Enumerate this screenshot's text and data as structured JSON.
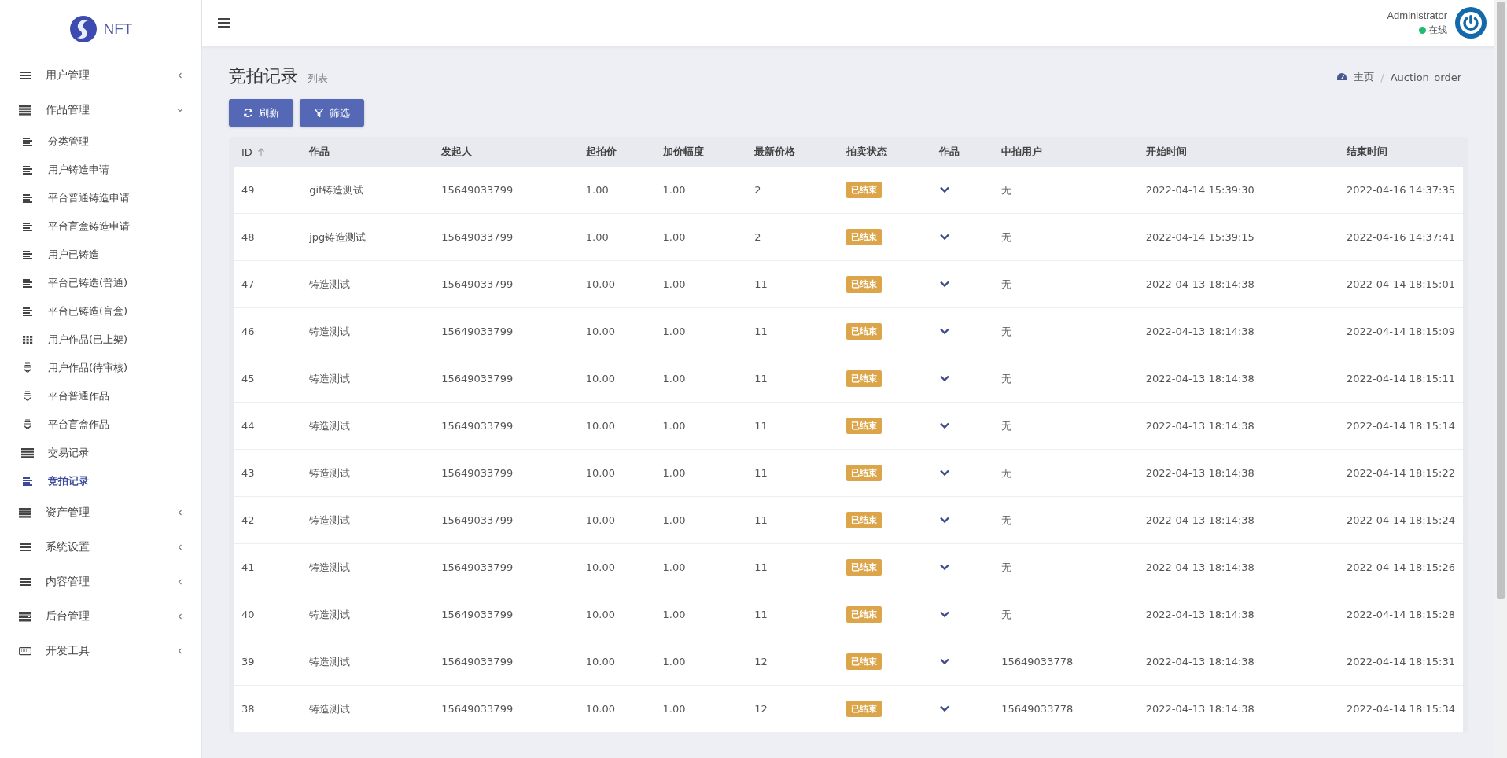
{
  "brand": {
    "name": "NFT"
  },
  "sidebar": {
    "items": [
      {
        "label": "用户管理",
        "kind": "lines",
        "expanded": false
      },
      {
        "label": "作品管理",
        "kind": "bars",
        "expanded": true,
        "children": [
          {
            "label": "分类管理",
            "kind": "align",
            "selected": false
          },
          {
            "label": "用户铸造申请",
            "kind": "align",
            "selected": false
          },
          {
            "label": "平台普通铸造申请",
            "kind": "align",
            "selected": false
          },
          {
            "label": "平台盲盒铸造申请",
            "kind": "align",
            "selected": false
          },
          {
            "label": "用户已铸造",
            "kind": "align",
            "selected": false
          },
          {
            "label": "平台已铸造(普通)",
            "kind": "align",
            "selected": false
          },
          {
            "label": "平台已铸造(盲盒)",
            "kind": "align",
            "selected": false
          },
          {
            "label": "用户作品(已上架)",
            "kind": "grid",
            "selected": false
          },
          {
            "label": "用户作品(待审核)",
            "kind": "print",
            "selected": false
          },
          {
            "label": "平台普通作品",
            "kind": "print",
            "selected": false
          },
          {
            "label": "平台盲盒作品",
            "kind": "print",
            "selected": false
          },
          {
            "label": "交易记录",
            "kind": "bars",
            "selected": false
          },
          {
            "label": "竞拍记录",
            "kind": "align",
            "selected": true
          }
        ]
      },
      {
        "label": "资产管理",
        "kind": "bars",
        "expanded": false
      },
      {
        "label": "系统设置",
        "kind": "lines",
        "expanded": false
      },
      {
        "label": "内容管理",
        "kind": "lines",
        "expanded": false
      },
      {
        "label": "后台管理",
        "kind": "server",
        "expanded": false
      },
      {
        "label": "开发工具",
        "kind": "keyboard",
        "expanded": false
      }
    ]
  },
  "user": {
    "name": "Administrator",
    "status": "在线",
    "color": "#1fbd6f"
  },
  "page": {
    "title": "竞拍记录",
    "subtitle": "列表"
  },
  "breadcrumb": [
    {
      "label": "主页",
      "kind": "home"
    },
    {
      "label": "Auction_order",
      "separator": "/"
    }
  ],
  "toolbar": [
    {
      "label": "刷新",
      "kind": "refresh"
    },
    {
      "label": "筛选",
      "kind": "filter"
    }
  ],
  "table": {
    "columns": [
      {
        "label": "ID",
        "sorted": true
      },
      {
        "label": "作品",
        "sorted": false
      },
      {
        "label": "发起人",
        "sorted": false
      },
      {
        "label": "起拍价",
        "sorted": false
      },
      {
        "label": "加价幅度",
        "sorted": false
      },
      {
        "label": "最新价格",
        "sorted": false
      },
      {
        "label": "拍卖状态",
        "sorted": false
      },
      {
        "label": "作品",
        "sorted": false
      },
      {
        "label": "中拍用户",
        "sorted": false
      },
      {
        "label": "开始时间",
        "sorted": false
      },
      {
        "label": "结束时间",
        "sorted": false
      }
    ],
    "rows": [
      {
        "id": "49",
        "work": "gif铸造测试",
        "initiator": "15649033799",
        "start_price": "1.00",
        "increment": "1.00",
        "latest": "2",
        "status": "已结束",
        "winner": "无",
        "start": "2022-04-14 15:39:30",
        "end": "2022-04-16 14:37:35"
      },
      {
        "id": "48",
        "work": "jpg铸造测试",
        "initiator": "15649033799",
        "start_price": "1.00",
        "increment": "1.00",
        "latest": "2",
        "status": "已结束",
        "winner": "无",
        "start": "2022-04-14 15:39:15",
        "end": "2022-04-16 14:37:41"
      },
      {
        "id": "47",
        "work": "铸造测试",
        "initiator": "15649033799",
        "start_price": "10.00",
        "increment": "1.00",
        "latest": "11",
        "status": "已结束",
        "winner": "无",
        "start": "2022-04-13 18:14:38",
        "end": "2022-04-14 18:15:01"
      },
      {
        "id": "46",
        "work": "铸造测试",
        "initiator": "15649033799",
        "start_price": "10.00",
        "increment": "1.00",
        "latest": "11",
        "status": "已结束",
        "winner": "无",
        "start": "2022-04-13 18:14:38",
        "end": "2022-04-14 18:15:09"
      },
      {
        "id": "45",
        "work": "铸造测试",
        "initiator": "15649033799",
        "start_price": "10.00",
        "increment": "1.00",
        "latest": "11",
        "status": "已结束",
        "winner": "无",
        "start": "2022-04-13 18:14:38",
        "end": "2022-04-14 18:15:11"
      },
      {
        "id": "44",
        "work": "铸造测试",
        "initiator": "15649033799",
        "start_price": "10.00",
        "increment": "1.00",
        "latest": "11",
        "status": "已结束",
        "winner": "无",
        "start": "2022-04-13 18:14:38",
        "end": "2022-04-14 18:15:14"
      },
      {
        "id": "43",
        "work": "铸造测试",
        "initiator": "15649033799",
        "start_price": "10.00",
        "increment": "1.00",
        "latest": "11",
        "status": "已结束",
        "winner": "无",
        "start": "2022-04-13 18:14:38",
        "end": "2022-04-14 18:15:22"
      },
      {
        "id": "42",
        "work": "铸造测试",
        "initiator": "15649033799",
        "start_price": "10.00",
        "increment": "1.00",
        "latest": "11",
        "status": "已结束",
        "winner": "无",
        "start": "2022-04-13 18:14:38",
        "end": "2022-04-14 18:15:24"
      },
      {
        "id": "41",
        "work": "铸造测试",
        "initiator": "15649033799",
        "start_price": "10.00",
        "increment": "1.00",
        "latest": "11",
        "status": "已结束",
        "winner": "无",
        "start": "2022-04-13 18:14:38",
        "end": "2022-04-14 18:15:26"
      },
      {
        "id": "40",
        "work": "铸造测试",
        "initiator": "15649033799",
        "start_price": "10.00",
        "increment": "1.00",
        "latest": "11",
        "status": "已结束",
        "winner": "无",
        "start": "2022-04-13 18:14:38",
        "end": "2022-04-14 18:15:28"
      },
      {
        "id": "39",
        "work": "铸造测试",
        "initiator": "15649033799",
        "start_price": "10.00",
        "increment": "1.00",
        "latest": "12",
        "status": "已结束",
        "winner": "15649033778",
        "start": "2022-04-13 18:14:38",
        "end": "2022-04-14 18:15:31"
      },
      {
        "id": "38",
        "work": "铸造测试",
        "initiator": "15649033799",
        "start_price": "10.00",
        "increment": "1.00",
        "latest": "12",
        "status": "已结束",
        "winner": "15649033778",
        "start": "2022-04-13 18:14:38",
        "end": "2022-04-14 18:15:34"
      }
    ]
  }
}
